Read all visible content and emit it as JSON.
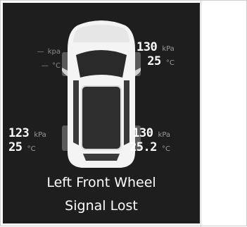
{
  "tires": {
    "front_left": {
      "pressure": "—",
      "pressure_unit": "kpa",
      "temp": "—",
      "temp_unit": "°C",
      "status": "signal-lost"
    },
    "front_right": {
      "pressure": "130",
      "pressure_unit": "kPa",
      "temp": "25",
      "temp_unit": "°C"
    },
    "rear_left": {
      "pressure": "123",
      "pressure_unit": "kPa",
      "temp": "25",
      "temp_unit": "°C"
    },
    "rear_right": {
      "pressure": "130",
      "pressure_unit": "kPa",
      "temp": "25.2",
      "temp_unit": "°C"
    }
  },
  "alert": {
    "line1": "Left Front Wheel",
    "line2": "Signal Lost"
  },
  "colors": {
    "panel_background": "#1e1e1e",
    "value_text": "#ffffff",
    "unit_text": "#9a9a9a",
    "car_body": "#f4f4f4"
  }
}
